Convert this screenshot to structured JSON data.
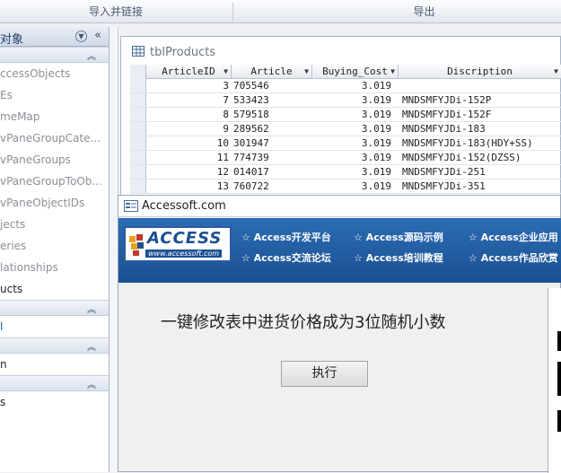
{
  "ribbon": {
    "group_import": "导入并链接",
    "group_export": "导出"
  },
  "nav": {
    "header": "对象",
    "items_tables": [
      {
        "label": "ccessObjects"
      },
      {
        "label": "Es"
      },
      {
        "label": "meMap"
      },
      {
        "label": "vPaneGroupCate..."
      },
      {
        "label": "vPaneGroups"
      },
      {
        "label": "vPaneGroupToOb..."
      },
      {
        "label": "vPaneObjectIDs"
      },
      {
        "label": "jects"
      },
      {
        "label": "eries"
      },
      {
        "label": "lationships"
      },
      {
        "label": "ucts"
      }
    ],
    "items_sec2": [
      {
        "label": "l"
      }
    ],
    "items_sec3": [
      {
        "label": "n"
      }
    ],
    "items_sec4": [
      {
        "label": "s"
      }
    ]
  },
  "table": {
    "title": "tblProducts",
    "columns": [
      "ArticleID",
      "Article",
      "Buying_Cost",
      "Discription"
    ],
    "rows": [
      {
        "id": "3",
        "article": "705546",
        "cost": "3.019",
        "desc": ""
      },
      {
        "id": "7",
        "article": "533423",
        "cost": "3.019",
        "desc": "MNDSMFYJDi-152P"
      },
      {
        "id": "8",
        "article": "579518",
        "cost": "3.019",
        "desc": "MNDSMFYJDi-152F"
      },
      {
        "id": "9",
        "article": "289562",
        "cost": "3.019",
        "desc": "MNDSMFYJDi-183"
      },
      {
        "id": "10",
        "article": "301947",
        "cost": "3.019",
        "desc": "MNDSMFYJDi-183(HDY+SS)"
      },
      {
        "id": "11",
        "article": "774739",
        "cost": "3.019",
        "desc": "MNDSMFYJDi-152(DZSS)"
      },
      {
        "id": "12",
        "article": "014017",
        "cost": "3.019",
        "desc": "MNDSMFYJDi-251"
      },
      {
        "id": "13",
        "article": "760722",
        "cost": "3.019",
        "desc": "MNDSMFYJDi-351"
      }
    ]
  },
  "form": {
    "title": "Accessoft.com",
    "logo_big": "ACCESS",
    "logo_small": "www.accessoft.com",
    "links": [
      "☆ Access开发平台",
      "☆ Access源码示例",
      "☆ Access企业应用",
      "☆ Access交流论坛",
      "☆ Access培训教程",
      "☆ Access作品欣赏"
    ],
    "heading": "一键修改表中进货价格成为3位随机小数",
    "run_button": "执行"
  },
  "colors": {
    "banner": "#1b4f92",
    "link_text": "#ffffff"
  }
}
